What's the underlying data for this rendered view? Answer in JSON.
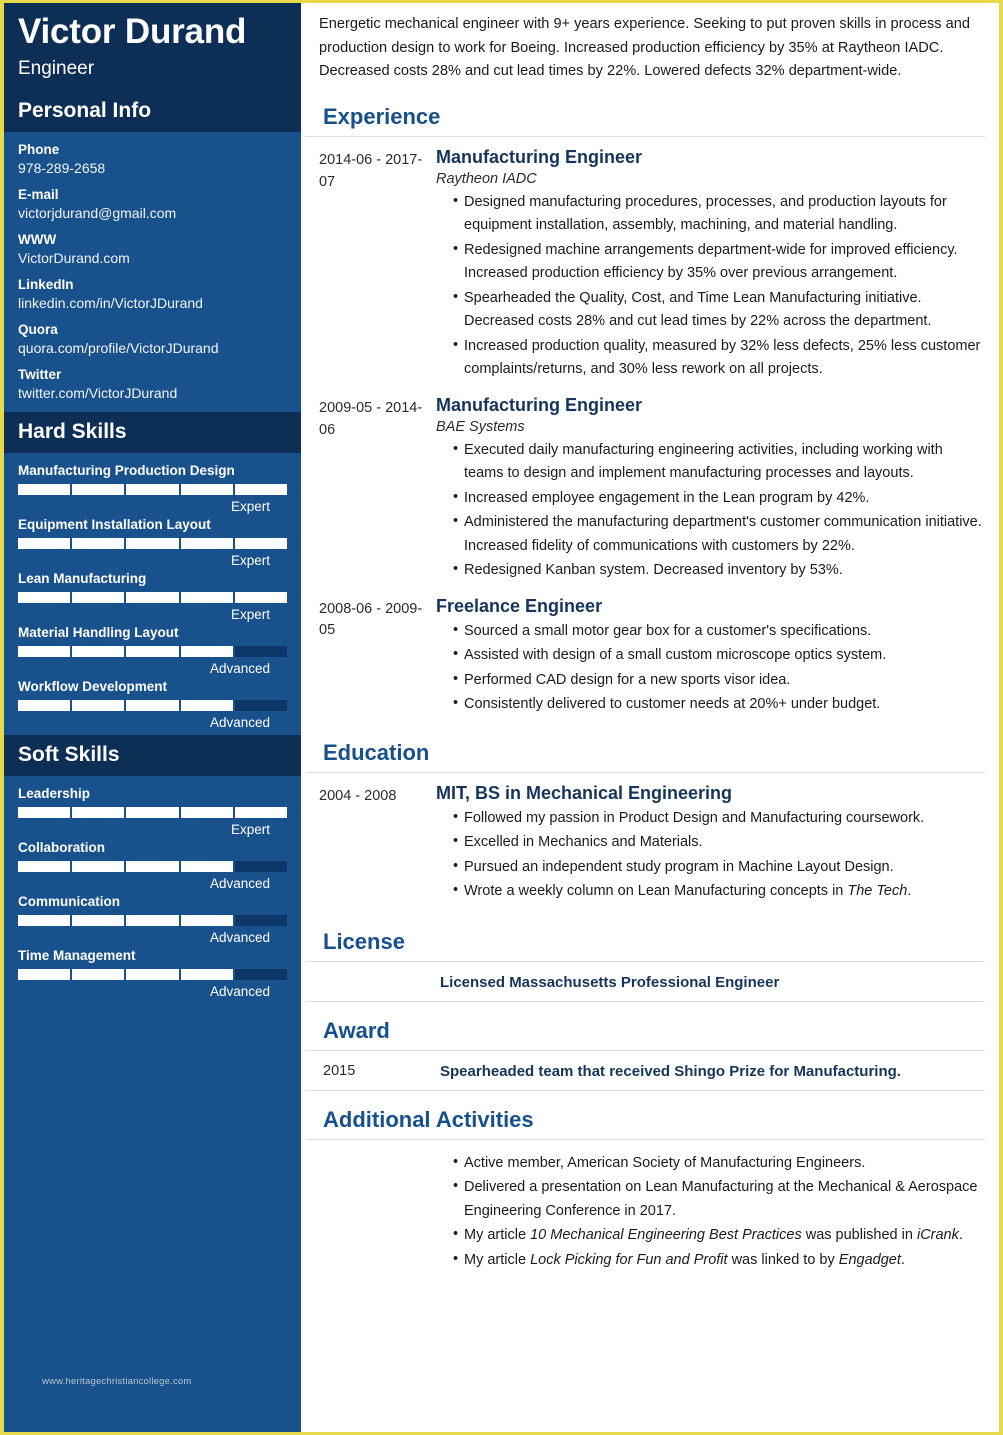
{
  "header": {
    "name": "Victor Durand",
    "job_title": "Engineer"
  },
  "sidebar": {
    "personal_info_heading": "Personal Info",
    "contacts": [
      {
        "label": "Phone",
        "value": "978-289-2658"
      },
      {
        "label": "E-mail",
        "value": "victorjdurand@gmail.com"
      },
      {
        "label": "WWW",
        "value": "VictorDurand.com"
      },
      {
        "label": "LinkedIn",
        "value": "linkedin.com/in/VictorJDurand"
      },
      {
        "label": "Quora",
        "value": "quora.com/profile/VictorJDurand"
      },
      {
        "label": "Twitter",
        "value": "twitter.com/VictorJDurand"
      }
    ],
    "hard_skills_heading": "Hard Skills",
    "hard_skills": [
      {
        "name": "Manufacturing Production Design",
        "level": "Expert",
        "percent": 100
      },
      {
        "name": "Equipment Installation Layout",
        "level": "Expert",
        "percent": 100
      },
      {
        "name": "Lean Manufacturing",
        "level": "Expert",
        "percent": 100
      },
      {
        "name": "Material Handling Layout",
        "level": "Advanced",
        "percent": 80
      },
      {
        "name": "Workflow Development",
        "level": "Advanced",
        "percent": 80
      }
    ],
    "soft_skills_heading": "Soft Skills",
    "soft_skills": [
      {
        "name": "Leadership",
        "level": "Expert",
        "percent": 100
      },
      {
        "name": "Collaboration",
        "level": "Advanced",
        "percent": 80
      },
      {
        "name": "Communication",
        "level": "Advanced",
        "percent": 80
      },
      {
        "name": "Time Management",
        "level": "Advanced",
        "percent": 80
      }
    ],
    "watermark": "www.heritagechristiancollege.com"
  },
  "main": {
    "summary": "Energetic mechanical engineer with 9+ years experience. Seeking to put proven skills in process and production design to work for Boeing. Increased production efficiency by 35% at Raytheon IADC. Decreased costs 28% and cut lead times by 22%. Lowered defects 32% department-wide.",
    "experience_heading": "Experience",
    "experience": [
      {
        "date": "2014-06 - 2017-07",
        "title": "Manufacturing Engineer",
        "company": "Raytheon IADC",
        "bullets": [
          "Designed manufacturing procedures, processes, and production layouts for equipment installation, assembly, machining, and material handling.",
          "Redesigned machine arrangements department-wide for improved efficiency. Increased production efficiency by 35% over previous arrangement.",
          "Spearheaded the Quality, Cost, and Time Lean Manufacturing initiative. Decreased costs 28% and cut lead times by 22% across the department.",
          "Increased production quality, measured by 32% less defects, 25% less customer complaints/returns, and 30% less rework on all projects."
        ]
      },
      {
        "date": "2009-05 - 2014-06",
        "title": "Manufacturing Engineer",
        "company": "BAE Systems",
        "bullets": [
          "Executed daily manufacturing engineering activities, including working with teams to design and implement manufacturing processes and layouts.",
          "Increased employee engagement in the Lean program by 42%.",
          "Administered the manufacturing department's customer communication initiative. Increased fidelity of communications with customers by 22%.",
          "Redesigned Kanban system. Decreased inventory by 53%."
        ]
      },
      {
        "date": "2008-06 - 2009-05",
        "title": "Freelance Engineer",
        "company": "",
        "bullets": [
          "Sourced a small motor gear box for a customer's specifications.",
          "Assisted with design of a small custom microscope optics system.",
          "Performed CAD design for a new sports visor idea.",
          "Consistently delivered to customer needs at 20%+ under budget."
        ]
      }
    ],
    "education_heading": "Education",
    "education": [
      {
        "date": "2004 - 2008",
        "title": "MIT, BS in Mechanical Engineering",
        "bullets": [
          "Followed my passion in Product Design and Manufacturing coursework.",
          "Excelled in Mechanics and Materials.",
          "Pursued an independent study program in Machine Layout Design.",
          "Wrote a weekly column on Lean Manufacturing concepts in The Tech."
        ]
      }
    ],
    "license_heading": "License",
    "license_text": "Licensed Massachusetts Professional Engineer",
    "award_heading": "Award",
    "award_year": "2015",
    "award_text": "Spearheaded team that received Shingo Prize for Manufacturing.",
    "additional_heading": "Additional Activities",
    "additional": [
      "Active member, American Society of Manufacturing Engineers.",
      "Delivered a presentation on Lean Manufacturing at the Mechanical & Aerospace Engineering Conference in 2017.",
      "My article 10 Mechanical Engineering Best Practices was published in iCrank.",
      "My article Lock Picking for Fun and Profit was linked to by Engadget."
    ]
  }
}
